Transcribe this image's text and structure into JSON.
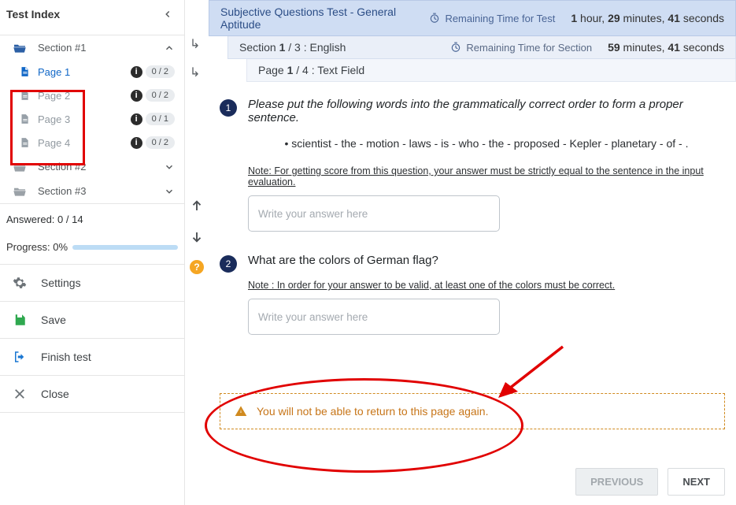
{
  "sidebar": {
    "title": "Test Index",
    "section1": {
      "label": "Section #1"
    },
    "section2": {
      "label": "Section #2"
    },
    "section3": {
      "label": "Section #3"
    },
    "pages": [
      {
        "label": "Page 1",
        "count": "0 / 2"
      },
      {
        "label": "Page 2",
        "count": "0 / 2"
      },
      {
        "label": "Page 3",
        "count": "0 / 1"
      },
      {
        "label": "Page 4",
        "count": "0 / 2"
      }
    ],
    "answered": "Answered: 0 / 14",
    "progress_label": "Progress: 0%",
    "settings": "Settings",
    "save": "Save",
    "finish": "Finish test",
    "close": "Close"
  },
  "header": {
    "test_title": "Subjective Questions Test - General Aptitude",
    "remain_test_label": "Remaining Time for Test",
    "remain_test_value_pre1": "1",
    "remain_test_value_mid1": " hour, ",
    "remain_test_value_pre2": "29",
    "remain_test_value_mid2": " minutes, ",
    "remain_test_value_pre3": "41",
    "remain_test_value_end": " seconds",
    "section_crumb_a": "Section  ",
    "section_crumb_b": "1",
    "section_crumb_c": " / 3 : English",
    "remain_sec_label": "Remaining Time for Section",
    "remain_sec_pre1": "59",
    "remain_sec_mid1": " minutes, ",
    "remain_sec_pre2": "41",
    "remain_sec_end": " seconds",
    "page_crumb_a": "Page  ",
    "page_crumb_b": "1",
    "page_crumb_c": " / 4 : Text Field"
  },
  "q1": {
    "num": "1",
    "prompt": "Please put the following words into the grammatically correct order to form a proper sentence.",
    "words": "• scientist - the - motion - laws - is - who - the - proposed - Kepler - planetary - of - .",
    "note": "Note: For getting score from this question, your answer must be strictly equal to the sentence in the input evaluation.",
    "placeholder": "Write your answer here"
  },
  "q2": {
    "num": "2",
    "prompt": "What are the colors of German flag?",
    "note": "Note : In order for your answer to be valid, at least one of the colors must be correct.",
    "placeholder": "Write your answer here"
  },
  "warning": "You will not be able to return to this page again.",
  "buttons": {
    "prev": "PREVIOUS",
    "next": "NEXT"
  },
  "help_glyph": "?",
  "info_glyph": "i"
}
